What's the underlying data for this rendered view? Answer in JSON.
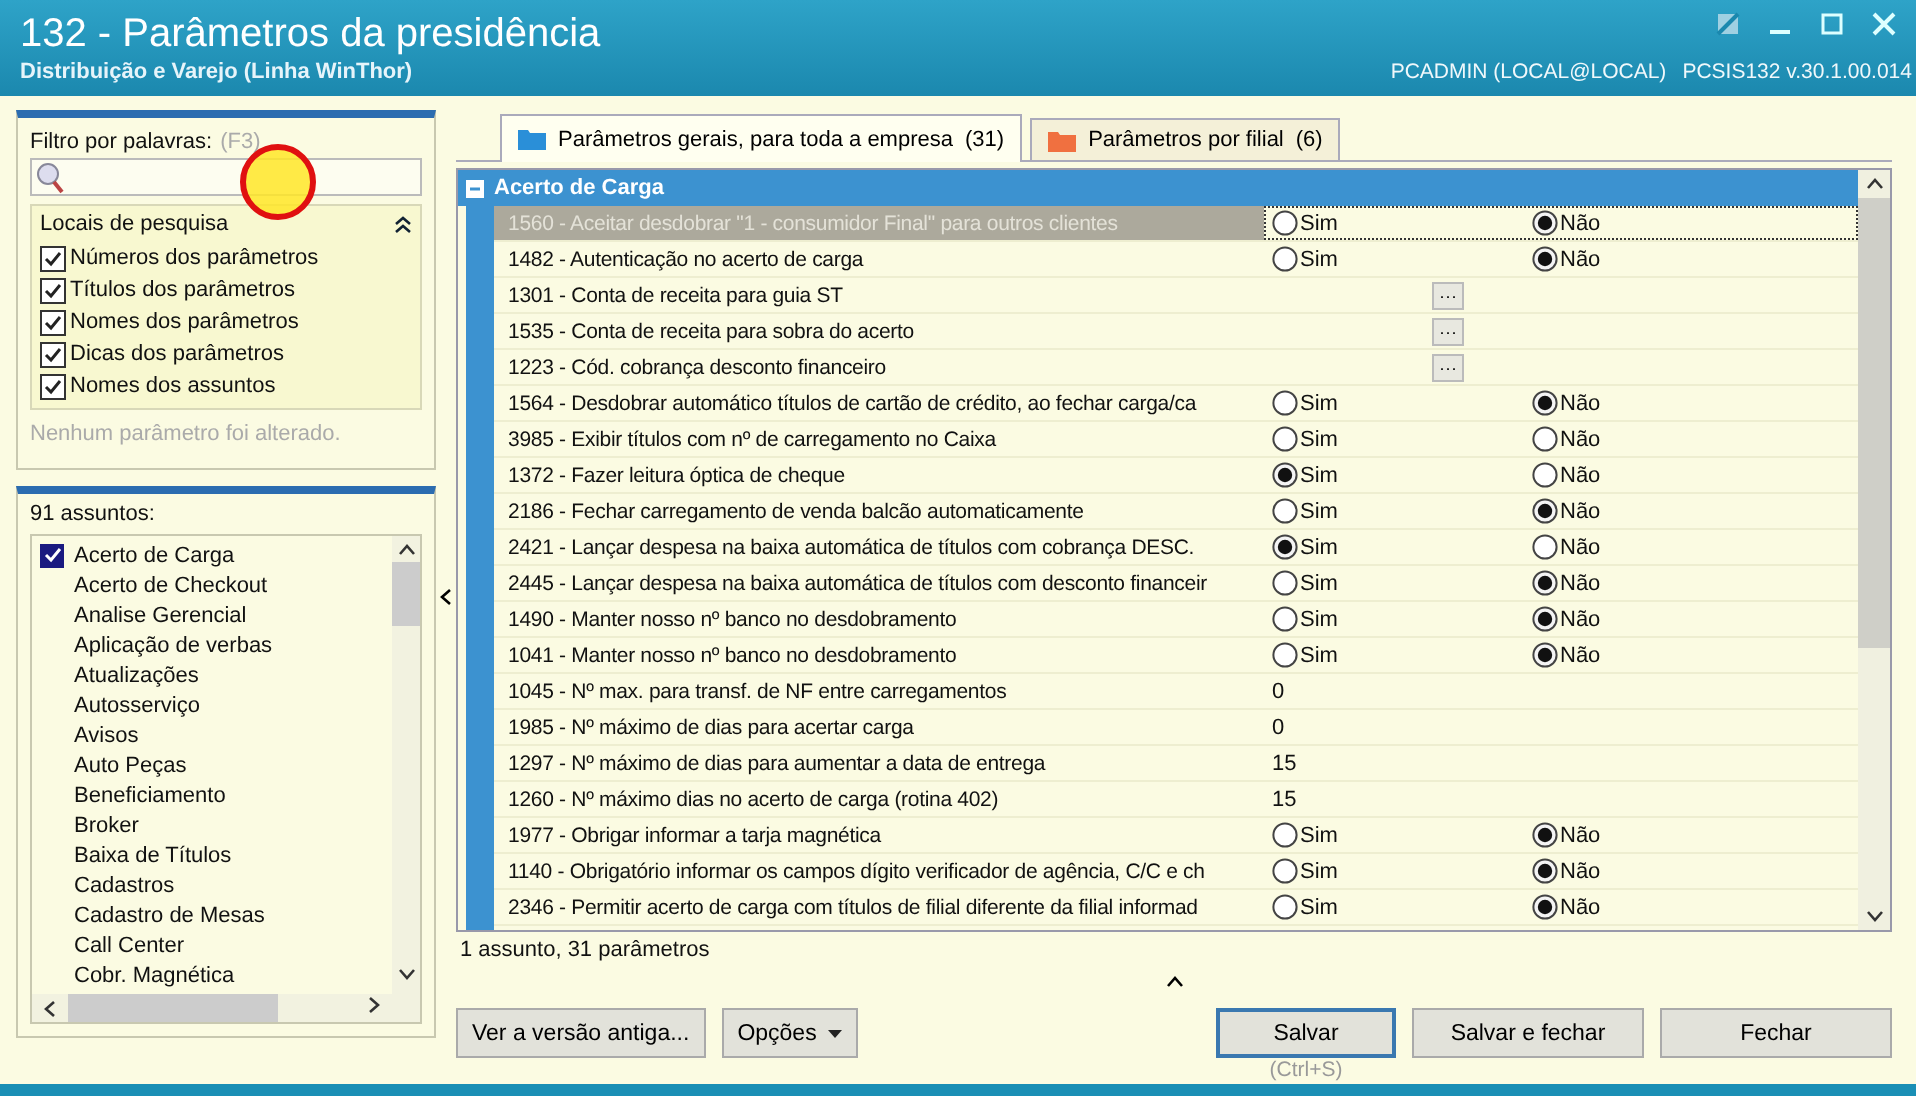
{
  "window": {
    "title": "132 - Parâmetros da presidência",
    "subtitle": "Distribuição e Varejo (Linha WinThor)",
    "user": "PCADMIN (LOCAL@LOCAL)",
    "version": "PCSIS132  v.30.1.00.014"
  },
  "filter": {
    "label": "Filtro por palavras:",
    "shortcut": "(F3)",
    "search_places_title": "Locais de pesquisa",
    "options": [
      {
        "label": "Números dos parâmetros",
        "checked": true
      },
      {
        "label": "Títulos dos parâmetros",
        "checked": true
      },
      {
        "label": "Nomes dos parâmetros",
        "checked": true
      },
      {
        "label": "Dicas dos parâmetros",
        "checked": true
      },
      {
        "label": "Nomes dos assuntos",
        "checked": true
      }
    ],
    "status": "Nenhum parâmetro foi alterado."
  },
  "subjects": {
    "count_label": "91 assuntos:",
    "items": [
      {
        "label": "Acerto de Carga",
        "checked": true
      },
      {
        "label": "Acerto de Checkout",
        "checked": false
      },
      {
        "label": "Analise Gerencial",
        "checked": false
      },
      {
        "label": "Aplicação de verbas",
        "checked": false
      },
      {
        "label": "Atualizações",
        "checked": false
      },
      {
        "label": "Autosserviço",
        "checked": false
      },
      {
        "label": "Avisos",
        "checked": false
      },
      {
        "label": "Auto Peças",
        "checked": false
      },
      {
        "label": "Beneficiamento",
        "checked": false
      },
      {
        "label": "Broker",
        "checked": false
      },
      {
        "label": "Baixa de Títulos",
        "checked": false
      },
      {
        "label": "Cadastros",
        "checked": false
      },
      {
        "label": "Cadastro de Mesas",
        "checked": false
      },
      {
        "label": "Call Center",
        "checked": false
      },
      {
        "label": "Cobr. Magnética",
        "checked": false
      }
    ]
  },
  "tabs": [
    {
      "label": "Parâmetros gerais, para toda a empresa",
      "count": "(31)",
      "selected": true,
      "color": "#2a8fd8"
    },
    {
      "label": "Parâmetros por filial",
      "count": "(6)",
      "selected": false,
      "color": "#f07040"
    }
  ],
  "grid": {
    "group": "Acerto de Carga",
    "rows": [
      {
        "kind": "bool",
        "label": "1560 - Aceitar desdobrar \"1 - consumidor Final\" para outros clientes",
        "selected": true,
        "options": [
          {
            "label": "Sim",
            "selected": false
          },
          {
            "label": "Não",
            "selected": true
          }
        ]
      },
      {
        "kind": "bool",
        "label": "1482 - Autenticação no acerto de carga",
        "selected": false,
        "options": [
          {
            "label": "Sim",
            "selected": false
          },
          {
            "label": "Não",
            "selected": true
          }
        ]
      },
      {
        "kind": "lookup",
        "label": "1301 - Conta de receita para guia ST",
        "selected": false,
        "button": "···"
      },
      {
        "kind": "lookup",
        "label": "1535 - Conta de receita para sobra do acerto",
        "selected": false,
        "button": "···"
      },
      {
        "kind": "lookup",
        "label": "1223 - Cód. cobrança desconto financeiro",
        "selected": false,
        "button": "···"
      },
      {
        "kind": "bool",
        "label": "1564 - Desdobrar automático títulos de cartão de crédito, ao fechar carga/ca",
        "selected": false,
        "options": [
          {
            "label": "Sim",
            "selected": false
          },
          {
            "label": "Não",
            "selected": true
          }
        ]
      },
      {
        "kind": "bool",
        "label": "3985 - Exibir títulos com nº de carregamento no Caixa",
        "selected": false,
        "options": [
          {
            "label": "Sim",
            "selected": false
          },
          {
            "label": "Não",
            "selected": false
          }
        ]
      },
      {
        "kind": "bool",
        "label": "1372 - Fazer leitura óptica de cheque",
        "selected": false,
        "options": [
          {
            "label": "Sim",
            "selected": true
          },
          {
            "label": "Não",
            "selected": false
          }
        ]
      },
      {
        "kind": "bool",
        "label": "2186 - Fechar carregamento de venda balcão automaticamente",
        "selected": false,
        "options": [
          {
            "label": "Sim",
            "selected": false
          },
          {
            "label": "Não",
            "selected": true
          }
        ]
      },
      {
        "kind": "bool",
        "label": "2421 - Lançar despesa na baixa automática de títulos com cobrança DESC.",
        "selected": false,
        "options": [
          {
            "label": "Sim",
            "selected": true
          },
          {
            "label": "Não",
            "selected": false
          }
        ]
      },
      {
        "kind": "bool",
        "label": "2445 - Lançar despesa na baixa automática de títulos com desconto financeir",
        "selected": false,
        "options": [
          {
            "label": "Sim",
            "selected": false
          },
          {
            "label": "Não",
            "selected": true
          }
        ]
      },
      {
        "kind": "bool",
        "label": "1490 - Manter nosso nº banco no desdobramento",
        "selected": false,
        "options": [
          {
            "label": "Sim",
            "selected": false
          },
          {
            "label": "Não",
            "selected": true
          }
        ]
      },
      {
        "kind": "bool",
        "label": "1041 - Manter nosso nº banco no desdobramento",
        "selected": false,
        "options": [
          {
            "label": "Sim",
            "selected": false
          },
          {
            "label": "Não",
            "selected": true
          }
        ]
      },
      {
        "kind": "number",
        "label": "1045 - Nº max. para transf. de NF entre carregamentos",
        "selected": false,
        "value": "0"
      },
      {
        "kind": "number",
        "label": "1985 - Nº máximo de dias para acertar carga",
        "selected": false,
        "value": "0"
      },
      {
        "kind": "number",
        "label": "1297 - Nº máximo de dias para aumentar a data de entrega",
        "selected": false,
        "value": "15"
      },
      {
        "kind": "number",
        "label": "1260 - Nº máximo dias no acerto de carga (rotina 402)",
        "selected": false,
        "value": "15"
      },
      {
        "kind": "bool",
        "label": "1977 - Obrigar informar a tarja magnética",
        "selected": false,
        "options": [
          {
            "label": "Sim",
            "selected": false
          },
          {
            "label": "Não",
            "selected": true
          }
        ]
      },
      {
        "kind": "bool",
        "label": "1140 - Obrigatório informar os campos dígito verificador de agência, C/C e ch",
        "selected": false,
        "options": [
          {
            "label": "Sim",
            "selected": false
          },
          {
            "label": "Não",
            "selected": true
          }
        ]
      },
      {
        "kind": "bool",
        "label": "2346 - Permitir acerto de carga com títulos de filial diferente da filial informad",
        "selected": false,
        "options": [
          {
            "label": "Sim",
            "selected": false
          },
          {
            "label": "Não",
            "selected": true
          }
        ]
      }
    ],
    "status": "1 assunto, 31 parâmetros"
  },
  "buttons": {
    "left": [
      {
        "label": "Ver a versão antiga...",
        "kind": "plain"
      },
      {
        "label": "Opções",
        "kind": "menu"
      }
    ],
    "right": [
      {
        "label": "Salvar",
        "kind": "default",
        "hint": "(Ctrl+S)"
      },
      {
        "label": "Salvar e fechar",
        "kind": "plain"
      },
      {
        "label": "Fechar",
        "kind": "plain"
      }
    ]
  }
}
